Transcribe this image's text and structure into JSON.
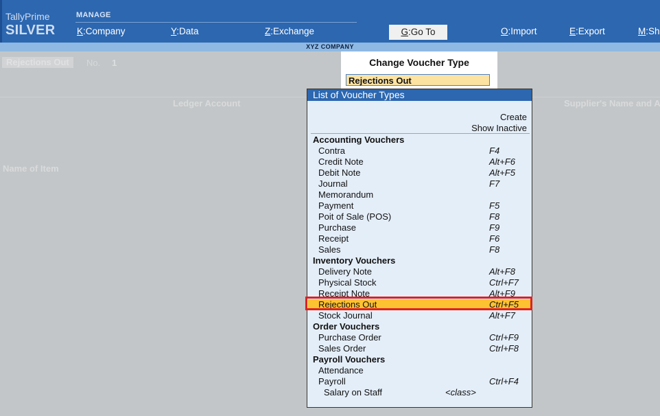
{
  "app": {
    "brand": "TallyPrime",
    "edition": "SILVER",
    "section": "MANAGE"
  },
  "menu": [
    {
      "key": "K",
      "label": "Company"
    },
    {
      "key": "Y",
      "label": "Data"
    },
    {
      "key": "Z",
      "label": "Exchange"
    },
    {
      "key": "G",
      "label": "Go To"
    },
    {
      "key": "O",
      "label": "Import"
    },
    {
      "key": "E",
      "label": "Export"
    },
    {
      "key": "M",
      "label": "Sh"
    }
  ],
  "company": "XYZ COMPANY",
  "background": {
    "voucher_type": "Rejections Out",
    "no_label": "No.",
    "no_value": "1",
    "col_ledger": "Ledger Account",
    "col_supplier": "Supplier's Name and A",
    "col_item": "Name of Item"
  },
  "change_voucher": {
    "title": "Change Voucher Type",
    "value": "Rejections Out"
  },
  "list": {
    "header": "List of Voucher Types",
    "options": [
      "Create",
      "Show Inactive"
    ],
    "rows": [
      {
        "type": "group",
        "label": "Accounting Vouchers",
        "shortcut": ""
      },
      {
        "type": "item",
        "label": "Contra",
        "shortcut": "F4"
      },
      {
        "type": "item",
        "label": "Credit Note",
        "shortcut": "Alt+F6"
      },
      {
        "type": "item",
        "label": "Debit Note",
        "shortcut": "Alt+F5"
      },
      {
        "type": "item",
        "label": "Journal",
        "shortcut": "F7"
      },
      {
        "type": "item",
        "label": "Memorandum",
        "shortcut": ""
      },
      {
        "type": "item",
        "label": "Payment",
        "shortcut": "F5"
      },
      {
        "type": "item",
        "label": "Poit of Sale (POS)",
        "shortcut": "F8"
      },
      {
        "type": "item",
        "label": "Purchase",
        "shortcut": "F9"
      },
      {
        "type": "item",
        "label": "Receipt",
        "shortcut": "F6"
      },
      {
        "type": "item",
        "label": "Sales",
        "shortcut": "F8"
      },
      {
        "type": "group",
        "label": "Inventory Vouchers",
        "shortcut": ""
      },
      {
        "type": "item",
        "label": "Delivery Note",
        "shortcut": "Alt+F8"
      },
      {
        "type": "item",
        "label": "Physical Stock",
        "shortcut": "Ctrl+F7"
      },
      {
        "type": "item",
        "label": "Receipt Note",
        "shortcut": "Alt+F9"
      },
      {
        "type": "item",
        "label": "Rejections Out",
        "shortcut": "Ctrl+F5",
        "selected": true
      },
      {
        "type": "item",
        "label": "Stock Journal",
        "shortcut": "Alt+F7"
      },
      {
        "type": "group",
        "label": "Order Vouchers",
        "shortcut": ""
      },
      {
        "type": "item",
        "label": "Purchase Order",
        "shortcut": "Ctrl+F9"
      },
      {
        "type": "item",
        "label": "Sales Order",
        "shortcut": "Ctrl+F8"
      },
      {
        "type": "group",
        "label": "Payroll Vouchers",
        "shortcut": ""
      },
      {
        "type": "item",
        "label": "Attendance",
        "shortcut": ""
      },
      {
        "type": "item",
        "label": "Payroll",
        "shortcut": "Ctrl+F4"
      },
      {
        "type": "sub",
        "label": "Salary on Staff",
        "shortcut": "<class>"
      }
    ]
  },
  "colors": {
    "topbar": "#2c67b0",
    "company_bar": "#8fb9e3",
    "list_bg": "#e4eef9",
    "selected_row": "#fcc232",
    "highlight_border": "#e02020",
    "input_bg": "#fde3a2"
  }
}
